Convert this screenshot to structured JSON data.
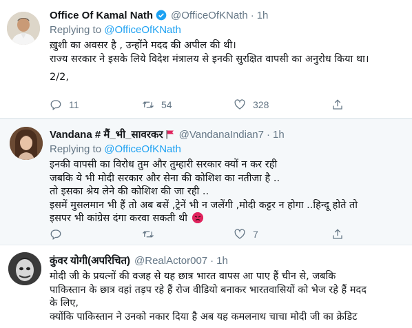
{
  "tweets": [
    {
      "name": "Office Of Kamal Nath",
      "handle": "@OfficeOfKNath",
      "time": "1h",
      "verified": true,
      "replying_prefix": "Replying to",
      "replying_to": "@OfficeOfKNath",
      "lines": [
        "ख़ुशी का अवसर है , उन्होंने मदद की अपील की थी।",
        "राज्य सरकार ने इसके लिये विदेश मंत्रालय से इनकी सुरक्षित वापसी का अनुरोध किया था।",
        "2/2,"
      ],
      "replies": "11",
      "retweets": "54",
      "likes": "328"
    },
    {
      "name": "Vandana # मैं_भी_सावरकर",
      "handle": "@VandanaIndian7",
      "time": "1h",
      "replying_prefix": "Replying to",
      "replying_to": "@OfficeOfKNath",
      "lines": [
        "इनकी वापसी का विरोध तुम और तुम्हारी सरकार क्यों न कर रही",
        "जबकि ये भी मोदी सरकार और सेना की कोशिश का नतीजा है ..",
        "तो इसका श्रेय लेने की कोशिश की जा रही ..",
        "इसमें मुसलमान भी हैं तो अब बसें ,ट्रेनें भी न जलेंगी ,मोदी कट्टर न होगा ..हिन्दू होते तो",
        "इसपर भी कांग्रेस दंगा करवा सकती थी"
      ],
      "replies": "",
      "retweets": "",
      "likes": "7"
    },
    {
      "name": "कुंवर योगी(अपरिचित)",
      "handle": "@RealActor007",
      "time": "1h",
      "lines": [
        "मोदी जी  के प्रयत्नों की वजह से यह छात्र भारत वापस आ पाए हैं चीन से, जबकि",
        "पाकिस्तान के छात्र वहां तड़प रहे हैं रोज वीडियो बनाकर भारतवासियों को भेज रहे हैं मदद",
        "के लिए,",
        " क्योंकि पाकिस्तान ने उनको नकार दिया है अब यह कमलनाथ चाचा मोदी जी का क्रेडिट"
      ]
    }
  ],
  "colors": {
    "accent": "#1da1f2",
    "muted": "#657786",
    "text": "#14171a",
    "reply_bg": "#f5f8fa"
  },
  "icons": [
    "reply-icon",
    "retweet-icon",
    "like-icon",
    "share-icon",
    "verified-icon",
    "red-flag-icon",
    "angry-face-emoji"
  ]
}
